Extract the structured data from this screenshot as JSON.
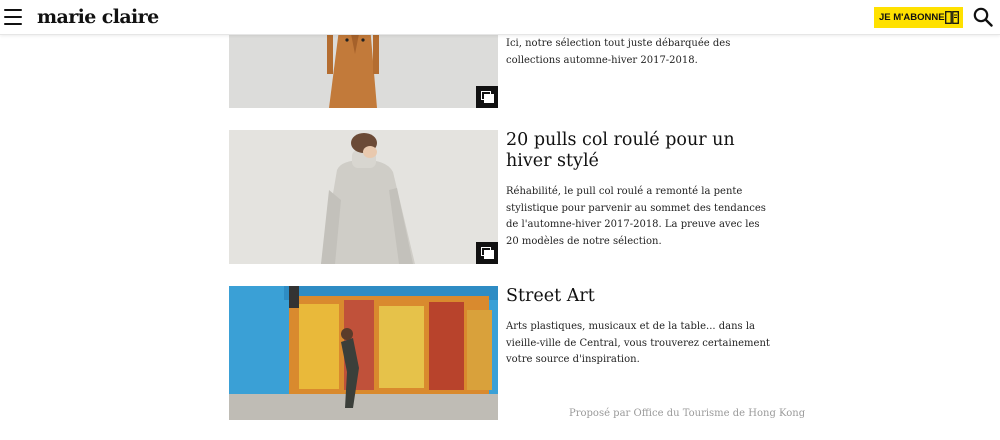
{
  "header": {
    "logo": "marie claire",
    "subscribe_label": "JE M'ABONNE",
    "icons": [
      "menu-icon",
      "magazine-icon",
      "search-icon"
    ]
  },
  "articles": [
    {
      "title": "",
      "description": "Ici, notre sélection tout juste débarquée des collections automne-hiver 2017-2018.",
      "has_gallery": true
    },
    {
      "title": "20 pulls col roulé pour un hiver stylé",
      "description": "Réhabilité, le pull col roulé a remonté la pente stylistique pour parvenir au sommet des tendances de l'automne-hiver 2017-2018. La preuve avec les 20 modèles de notre sélection.",
      "has_gallery": true
    },
    {
      "title": "Street Art",
      "description": "Arts plastiques, musicaux et de la table... dans la vieille-ville de Central, vous trouverez certainement votre source d'inspiration.",
      "sponsor": "Proposé par Office du Tourisme de Hong Kong",
      "has_gallery": false
    }
  ],
  "colors": {
    "accent_yellow": "#ffe100",
    "text": "#111111",
    "sponsor_gray": "#9a9a9a"
  }
}
